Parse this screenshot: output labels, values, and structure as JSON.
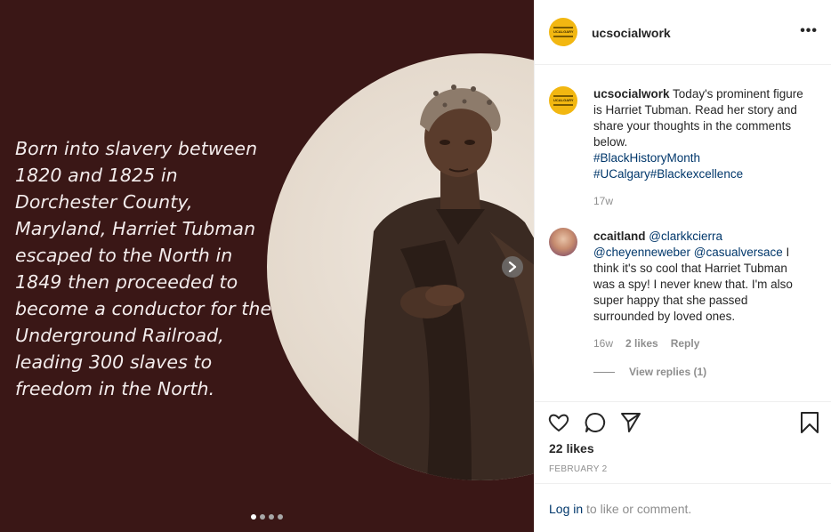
{
  "post": {
    "media": {
      "text": "Born into slavery between 1820 and 1825 in Dorchester County, Maryland, Harriet Tubman escaped to the North in 1849 then proceeded to become a conductor for the Underground Railroad, leading 300 slaves to freedom in the North.",
      "dot_count": 4,
      "active_dot": 0,
      "next_icon": "chevron-right-icon"
    },
    "header": {
      "username": "ucsocialwork",
      "avatar_text": "UNIVERSITY OF CALGARY",
      "more_label": "•••"
    },
    "caption": {
      "username": "ucsocialwork",
      "text": " Today's prominent figure is Harriet Tubman. Read her story and share your thoughts in the comments below.",
      "tags": [
        "#BlackHistoryMonth",
        "#UCalgary#Blackexcellence"
      ],
      "time": "17w"
    },
    "comment": {
      "username": "ccaitland",
      "mention1": "@clarkkcierra",
      "mention2": "@cheyenneweber",
      "mention3": "@casualversace",
      "text": " I think it's so cool that Harriet Tubman was a spy! I never knew that. I'm also super happy that she passed surrounded by loved ones.",
      "time": "16w",
      "likes": "2 likes",
      "reply": "Reply",
      "view_replies": "View replies (1)"
    },
    "actions": {
      "likes": "22 likes",
      "date": "FEBRUARY 2",
      "icons": [
        "heart-icon",
        "comment-icon",
        "share-icon",
        "bookmark-icon"
      ]
    },
    "login": {
      "link": "Log in",
      "rest": " to like or comment."
    },
    "colors": {
      "media_bg": "#3a1716",
      "link": "#00376b",
      "muted": "#8e8e8e",
      "avatar": "#f2b711"
    }
  }
}
